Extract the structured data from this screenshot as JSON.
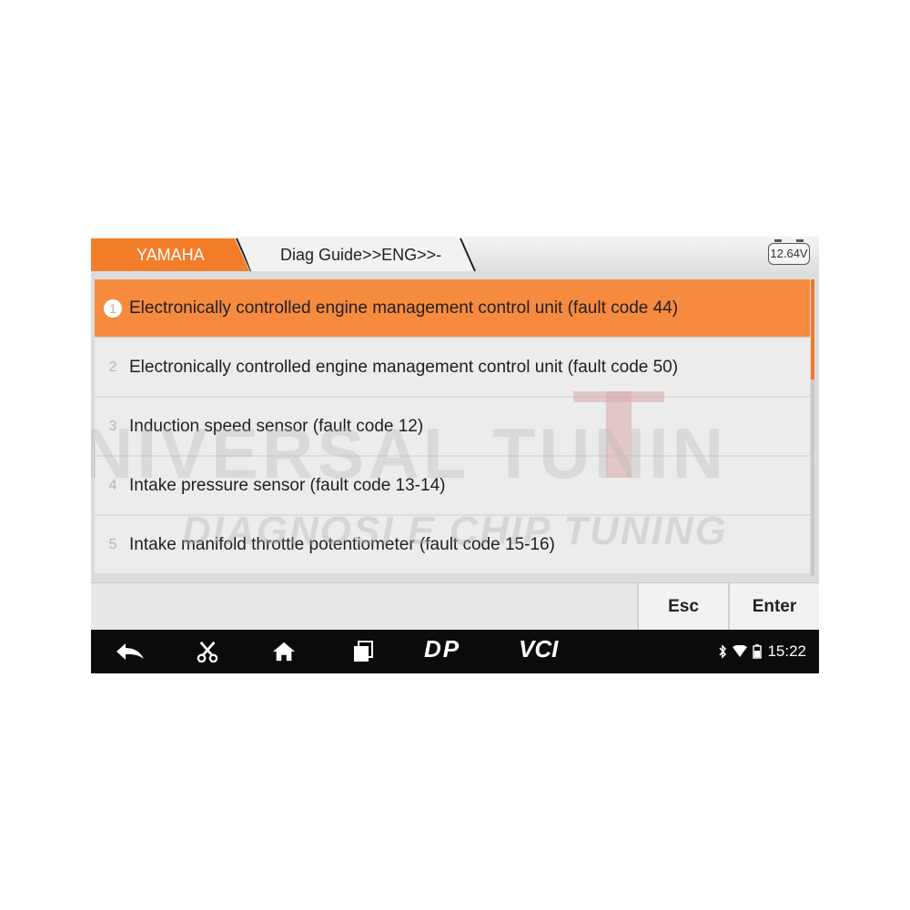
{
  "header": {
    "brand": "YAMAHA",
    "path": "Diag Guide>>ENG>>-",
    "voltage": "12.64V"
  },
  "list": {
    "items": [
      {
        "num": "1",
        "label": "Electronically controlled engine management control unit (fault code 44)",
        "selected": true
      },
      {
        "num": "2",
        "label": "Electronically controlled engine management control unit (fault code 50)",
        "selected": false
      },
      {
        "num": "3",
        "label": "Induction speed sensor (fault code 12)",
        "selected": false
      },
      {
        "num": "4",
        "label": "Intake pressure sensor (fault code 13-14)",
        "selected": false
      },
      {
        "num": "5",
        "label": "Intake manifold throttle potentiometer (fault code 15-16)",
        "selected": false
      }
    ]
  },
  "buttons": {
    "esc": "Esc",
    "enter": "Enter"
  },
  "watermark": {
    "line1": "NIVERSAL TUNIN",
    "line2": "DIAGNOSI E CHIP TUNING"
  },
  "navbar": {
    "icons": [
      "back-icon",
      "scissors-icon",
      "home-icon",
      "recent-apps-icon",
      "dp-icon",
      "vci-icon"
    ],
    "dp_label": "DP",
    "vci_label": "VCI",
    "time": "15:22"
  },
  "colors": {
    "accent": "#f68b3f",
    "row_bg": "#ececec",
    "navbar_bg": "#0b0b0b"
  }
}
